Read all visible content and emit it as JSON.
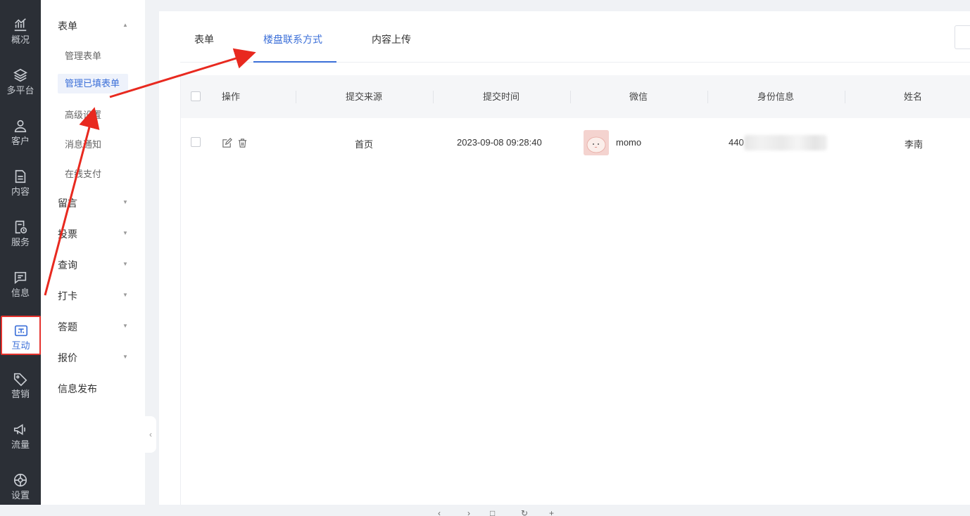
{
  "rail": {
    "items": [
      {
        "label": "概况",
        "icon": "chart-icon"
      },
      {
        "label": "多平台",
        "icon": "layers-icon"
      },
      {
        "label": "客户",
        "icon": "user-icon"
      },
      {
        "label": "内容",
        "icon": "document-icon"
      },
      {
        "label": "服务",
        "icon": "service-icon"
      },
      {
        "label": "信息",
        "icon": "message-icon"
      },
      {
        "label": "互动",
        "icon": "interaction-icon"
      },
      {
        "label": "营销",
        "icon": "tag-icon"
      },
      {
        "label": "流量",
        "icon": "megaphone-icon"
      },
      {
        "label": "设置",
        "icon": "settings-icon"
      }
    ],
    "active_color": "#3b6fd8",
    "highlight_color": "#e5322d"
  },
  "submenu": {
    "group_form": "表单",
    "items": [
      "管理表单",
      "管理已填表单",
      "高级设置",
      "消息通知",
      "在线支付"
    ],
    "groups": [
      "留言",
      "投票",
      "查询",
      "打卡",
      "答题",
      "报价"
    ],
    "publish": "信息发布"
  },
  "tabs": [
    "表单",
    "楼盘联系方式",
    "内容上传"
  ],
  "table": {
    "headers": [
      "操作",
      "提交来源",
      "提交时间",
      "微信",
      "身份信息",
      "姓名"
    ],
    "rows": [
      {
        "source": "首页",
        "time": "2023-09-08 09:28:40",
        "wechat": "momo",
        "identity": "440",
        "name": "李南"
      }
    ]
  },
  "annotation_color": "#e8291f"
}
